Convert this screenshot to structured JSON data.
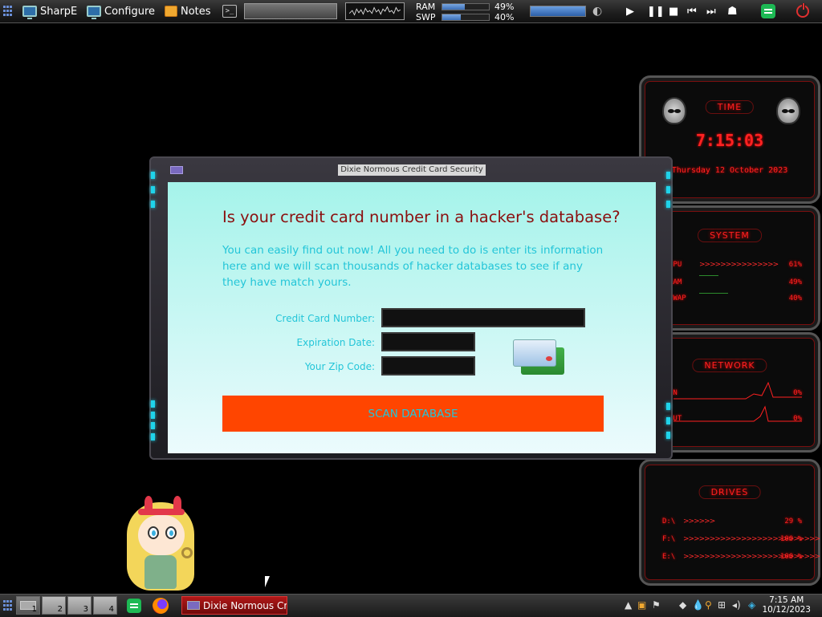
{
  "top_panel": {
    "launchers": [
      {
        "label": "SharpE",
        "icon": "monitor-icon"
      },
      {
        "label": "Configure",
        "icon": "monitor-icon"
      },
      {
        "label": "Notes",
        "icon": "notes-icon"
      }
    ],
    "terminal_icon_text": ">_",
    "ram_label": "RAM",
    "ram_percent": "49%",
    "ram_fraction": 0.49,
    "swp_label": "SWP",
    "swp_percent": "40%",
    "swp_fraction": 0.4,
    "media_controls": [
      "play",
      "pause",
      "stop",
      "previous",
      "next"
    ]
  },
  "dialog": {
    "title": "Dixie Normous Credit Card Security",
    "headline": "Is your credit card number in a hacker's database?",
    "paragraph": "You can easily find out now! All you need to do is enter its information here and we will scan thousands of hacker databases to see if any they have match yours.",
    "fields": {
      "card_number_label": "Credit Card Number:",
      "card_number_value": "",
      "expiration_label": "Expiration Date:",
      "expiration_value": "",
      "zip_label": "Your Zip Code:",
      "zip_value": ""
    },
    "scan_button": "SCAN DATABASE",
    "colors": {
      "accent_button": "#ff4500",
      "headline": "#8b0f0f",
      "text": "#23c5d8"
    }
  },
  "gadgets": {
    "time": {
      "title": "TIME",
      "clock": "7:15:03",
      "date": "Thursday 12 October 2023"
    },
    "system": {
      "title": "SYSTEM",
      "rows": [
        {
          "label": "CPU",
          "value": "61%",
          "bar": ">>>>>>>>>>>>>>>"
        },
        {
          "label": "RAM",
          "value": "49%",
          "bar": ""
        },
        {
          "label": "SWAP",
          "value": "40%",
          "bar": ""
        }
      ]
    },
    "network": {
      "title": "NETWORK",
      "rows": [
        {
          "label": "IN",
          "value": "0%"
        },
        {
          "label": "OUT",
          "value": "0%"
        }
      ]
    },
    "drives": {
      "title": "DRIVES",
      "rows": [
        {
          "label": "D:\\",
          "value": "29 %",
          "bar": ">>>>>>"
        },
        {
          "label": "F:\\",
          "value": "100 %",
          "bar": ">>>>>>>>>>>>>>>>>>>>>>>>>>"
        },
        {
          "label": "E:\\",
          "value": "100 %",
          "bar": ">>>>>>>>>>>>>>>>>>>>>>>>>>"
        }
      ]
    }
  },
  "taskbar": {
    "workspaces": [
      "1",
      "2",
      "3",
      "4"
    ],
    "active_task": "Dixie Normous Credi...",
    "clock_time": "7:15 AM",
    "clock_date": "10/12/2023"
  }
}
